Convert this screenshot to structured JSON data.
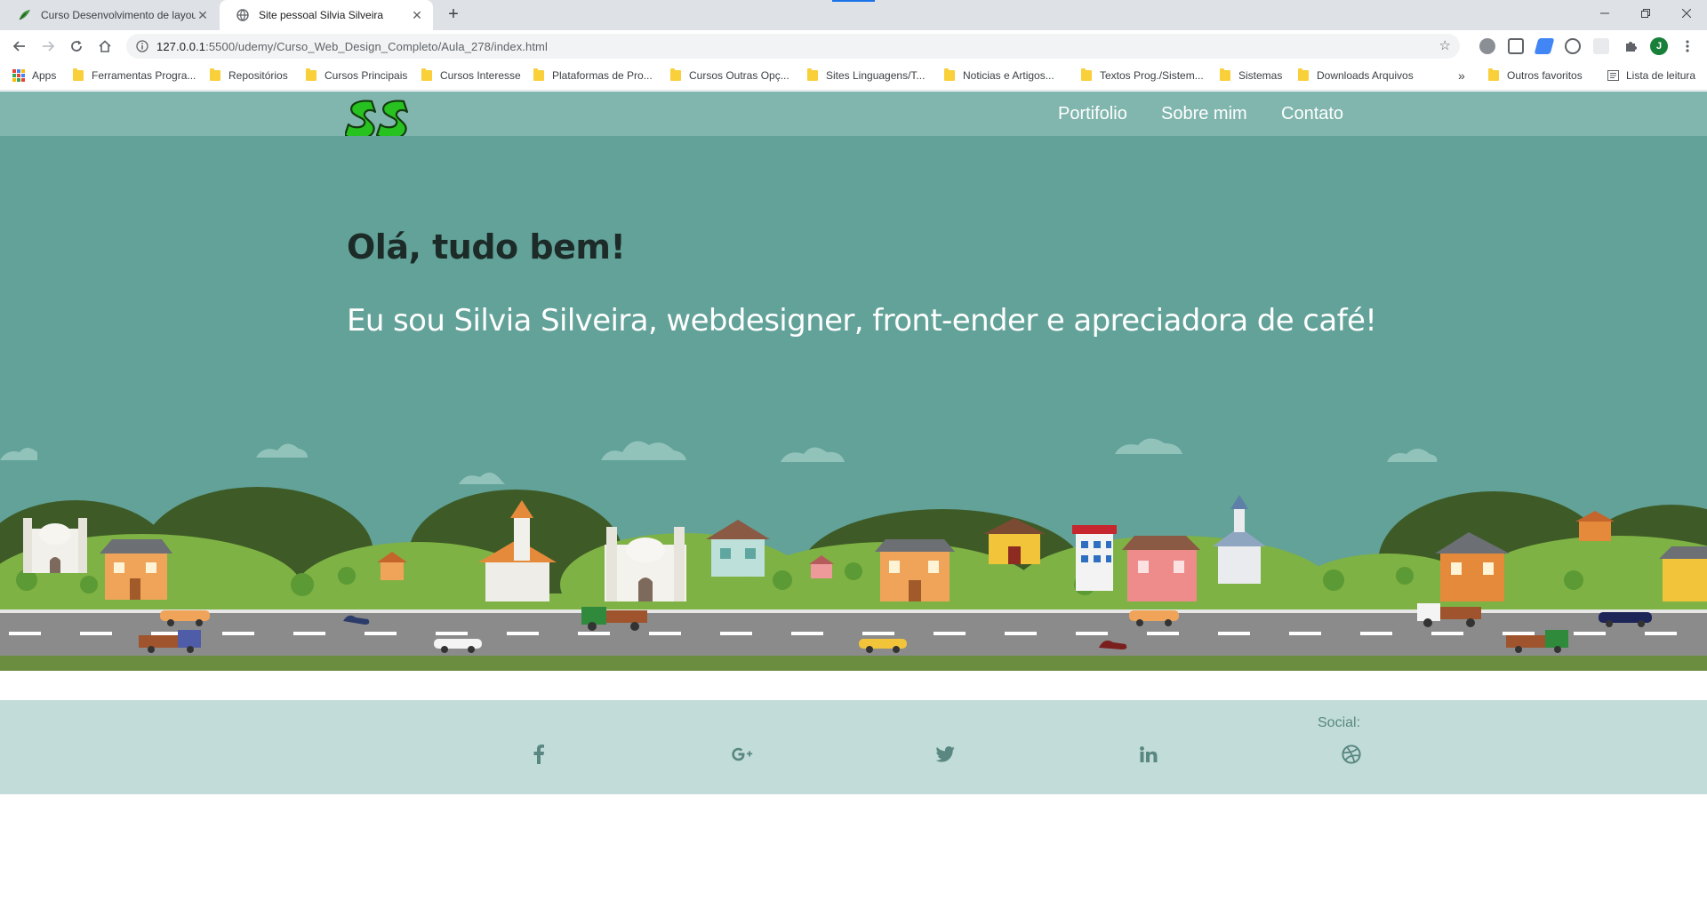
{
  "browser": {
    "tabs": [
      {
        "title": "Curso Desenvolvimento de layou",
        "active": false
      },
      {
        "title": "Site pessoal Silvia Silveira",
        "active": true
      }
    ],
    "url_host": "127.0.0.1",
    "url_path": ":5500/udemy/Curso_Web_Design_Completo/Aula_278/index.html",
    "profile_initial": "J",
    "bookmarks": [
      "Apps",
      "Ferramentas Progra...",
      "Repositórios",
      "Cursos Principais",
      "Cursos Interesse",
      "Plataformas de Pro...",
      "Cursos Outras Opç...",
      "Sites Linguagens/T...",
      "Noticias e Artigos...",
      "Textos Prog./Sistem...",
      "Sistemas",
      "Downloads Arquivos"
    ],
    "bookmarks_overflow": "»",
    "other_bookmarks": "Outros favoritos",
    "reading_list": "Lista de leitura"
  },
  "site": {
    "nav": [
      "Portifolio",
      "Sobre mim",
      "Contato"
    ],
    "hero_title": "Olá, tudo bem!",
    "hero_subtitle": "Eu sou Silvia Silveira, webdesigner, front-ender e apreciadora de café!",
    "social_label": "Social:",
    "social_icons": [
      "facebook-icon",
      "google-plus-icon",
      "twitter-icon",
      "linkedin-icon",
      "dribbble-icon"
    ]
  },
  "colors": {
    "header": "#81b6ae",
    "hero": "#62a298",
    "footer": "#c2ddd9",
    "road": "#8a8b8a",
    "grass": "#6a8d3f"
  }
}
